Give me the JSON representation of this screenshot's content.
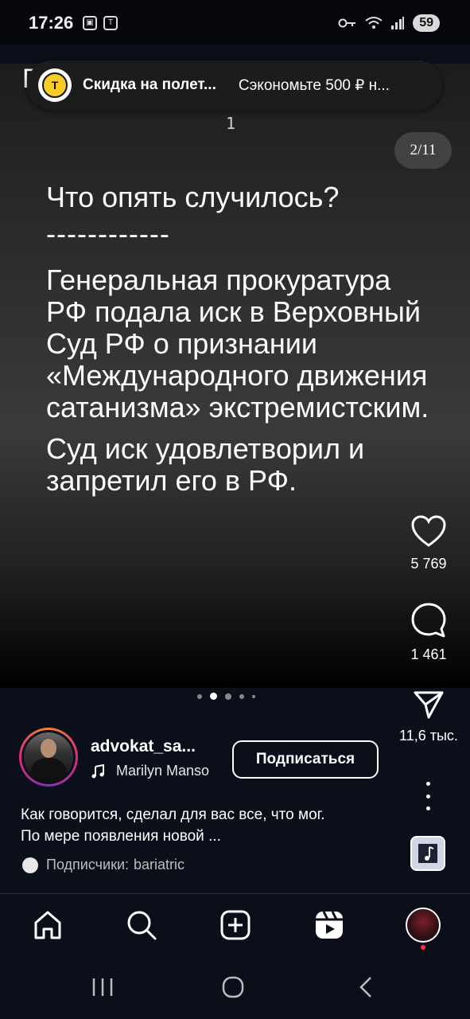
{
  "status_bar": {
    "time": "17:26",
    "battery": "59"
  },
  "banner": {
    "title": "Скидка на полет...",
    "subtitle": "Сэкономьте 500 ₽ н...",
    "logo_letter": "T"
  },
  "post": {
    "partial_text_top": "Г",
    "top_number": "1",
    "page_counter": "2/11",
    "title": "Что опять случилось?",
    "dashes": "------------",
    "paragraph1": "Генеральная прокуратура РФ подала иск в Верховный Суд РФ о признании «Международного движения сатанизма» экстремистским.",
    "paragraph2": "Суд иск удовлетворил и запретил его в РФ."
  },
  "actions": {
    "likes": "5 769",
    "comments": "1 461",
    "shares": "11,6 тыс."
  },
  "carousel": {
    "total_visible_dots": 5,
    "active_index": 1
  },
  "author": {
    "username": "advokat_sa...",
    "music": "Marilyn Manso",
    "follow_label": "Подписаться"
  },
  "caption": {
    "line1": "Как говорится, сделал для вас все, что мог.",
    "line2": "По мере появления новой ..."
  },
  "followers": {
    "label": "Подписчики:",
    "name": "bariatric"
  },
  "icons": {
    "home": "home-icon",
    "search": "search-icon",
    "create": "plus-square-icon",
    "reels": "reels-icon",
    "like": "heart-icon",
    "comment": "comment-icon",
    "share": "send-icon"
  }
}
